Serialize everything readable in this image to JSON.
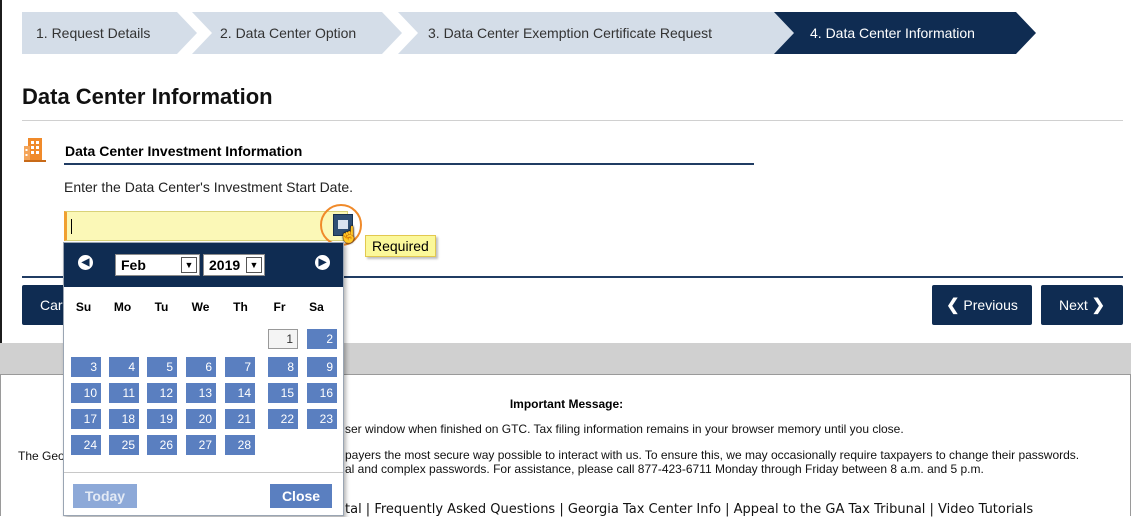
{
  "wizard": {
    "steps": [
      {
        "label": "1. Request Details"
      },
      {
        "label": "2. Data Center Option"
      },
      {
        "label": "3. Data Center Exemption Certificate Request"
      },
      {
        "label": "4. Data Center Information",
        "active": true
      }
    ]
  },
  "page": {
    "title": "Data Center Information",
    "section_title": "Data Center Investment Information",
    "instructions": "Enter the Data Center's Investment Start Date.",
    "date_value": "",
    "required_tooltip": "Required"
  },
  "buttons": {
    "cancel": "Car",
    "previous": "Previous",
    "next": "Next"
  },
  "calendar": {
    "month": "Feb",
    "year": "2019",
    "weekdays": [
      "Su",
      "Mo",
      "Tu",
      "We",
      "Th",
      "Fr",
      "Sa"
    ],
    "days": [
      {
        "d": "1",
        "col": 5,
        "row": 0,
        "today": true
      },
      {
        "d": "2",
        "col": 6,
        "row": 0
      },
      {
        "d": "3",
        "col": 0,
        "row": 1
      },
      {
        "d": "4",
        "col": 1,
        "row": 1
      },
      {
        "d": "5",
        "col": 2,
        "row": 1
      },
      {
        "d": "6",
        "col": 3,
        "row": 1
      },
      {
        "d": "7",
        "col": 4,
        "row": 1
      },
      {
        "d": "8",
        "col": 5,
        "row": 1
      },
      {
        "d": "9",
        "col": 6,
        "row": 1
      },
      {
        "d": "10",
        "col": 0,
        "row": 2
      },
      {
        "d": "11",
        "col": 1,
        "row": 2
      },
      {
        "d": "12",
        "col": 2,
        "row": 2
      },
      {
        "d": "13",
        "col": 3,
        "row": 2
      },
      {
        "d": "14",
        "col": 4,
        "row": 2
      },
      {
        "d": "15",
        "col": 5,
        "row": 2
      },
      {
        "d": "16",
        "col": 6,
        "row": 2
      },
      {
        "d": "17",
        "col": 0,
        "row": 3
      },
      {
        "d": "18",
        "col": 1,
        "row": 3
      },
      {
        "d": "19",
        "col": 2,
        "row": 3
      },
      {
        "d": "20",
        "col": 3,
        "row": 3
      },
      {
        "d": "21",
        "col": 4,
        "row": 3
      },
      {
        "d": "22",
        "col": 5,
        "row": 3
      },
      {
        "d": "23",
        "col": 6,
        "row": 3
      },
      {
        "d": "24",
        "col": 0,
        "row": 4
      },
      {
        "d": "25",
        "col": 1,
        "row": 4
      },
      {
        "d": "26",
        "col": 2,
        "row": 4
      },
      {
        "d": "27",
        "col": 3,
        "row": 4
      },
      {
        "d": "28",
        "col": 4,
        "row": 4
      }
    ],
    "today_label": "Today",
    "close_label": "Close"
  },
  "footer": {
    "title": "Important Message:",
    "line1": "ser window when finished on GTC. Tax filing information remains in your browser memory until you close.",
    "line2_left": "The Geo",
    "line2": "payers the most secure way possible to interact with us. To ensure this, we may occasionally require taxpayers to change their passwords.",
    "line3": "al and complex passwords. For assistance, please call 877-423-6711 Monday through Friday between 8 a.m. and 5 p.m.",
    "links": "tal | Frequently Asked Questions | Georgia Tax Center Info | Appeal to the GA Tax Tribunal | Video Tutorials"
  },
  "colors": {
    "navy": "#0f2c52",
    "step_inactive": "#d4dde8",
    "calendar_day": "#5a7fc0",
    "input_bg": "#fbf8b7",
    "accent_orange": "#f08a2a"
  }
}
